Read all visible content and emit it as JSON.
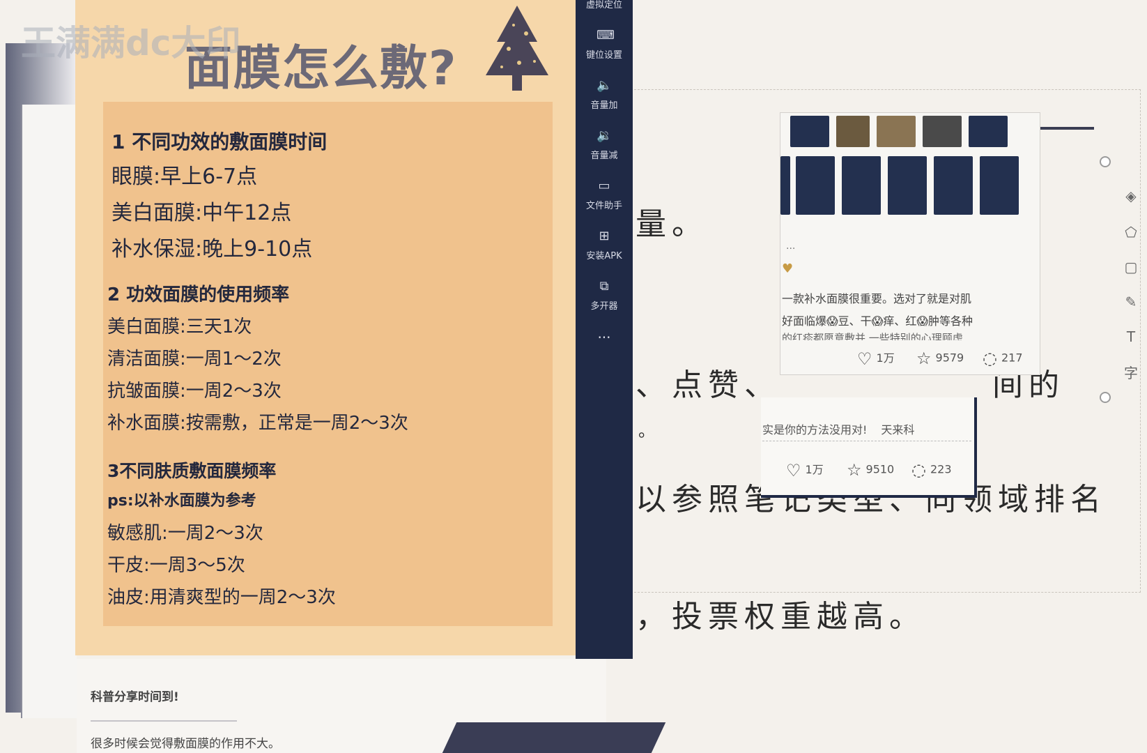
{
  "watermark": "王满满dc大印",
  "poster": {
    "title": "面膜怎么敷?",
    "sections": [
      {
        "heading": "1  不同功效的敷面膜时间",
        "lines": [
          "眼膜:早上6-7点",
          "美白面膜:中午12点",
          "补水保湿:晚上9-10点"
        ]
      },
      {
        "heading": "2  功效面膜的使用频率",
        "lines": [
          "美白面膜:三天1次",
          "清洁面膜:一周1～2次",
          "抗皱面膜:一周2～3次",
          "补水面膜:按需敷，正常是一周2～3次"
        ]
      },
      {
        "heading": "3不同肤质敷面膜频率",
        "subheading": "ps:以补水面膜为参考",
        "lines": [
          "敏感肌:一周2～3次",
          "干皮:一周3～5次",
          "油皮:用清爽型的一周2～3次"
        ]
      }
    ]
  },
  "sidebar": {
    "top_partial": "虚拟定位",
    "items": [
      {
        "label": "键位设置",
        "icon": "keyboard-icon"
      },
      {
        "label": "音量加",
        "icon": "volume-up-icon"
      },
      {
        "label": "音量减",
        "icon": "volume-down-icon"
      },
      {
        "label": "文件助手",
        "icon": "monitor-icon"
      },
      {
        "label": "安装APK",
        "icon": "install-apk-icon"
      },
      {
        "label": "多开器",
        "icon": "multi-open-icon"
      }
    ],
    "more": "..."
  },
  "bottom_card": {
    "line1": "科普分享时间到!",
    "line2": "很多时候会觉得敷面膜的作用不大。"
  },
  "document": {
    "line1": "量。",
    "line2": "、点赞、",
    "line2_tail": "间的",
    "line3": "。",
    "line4": "以参照笔记类型、同领域排名",
    "line5": "，投票权重越高。"
  },
  "card1": {
    "dots": "...",
    "line1": "一款补水面膜很重要。选对了就是对肌",
    "line2": "好面临爆😱豆、干😱痒、红😱肿等各种",
    "line3": "的红疹都愿意敷并 一些特别的心理顾虑",
    "likes": "1万",
    "favorites": "9579",
    "comments": "217"
  },
  "card2": {
    "text": "实是你的方法没用对!",
    "text_tail": "天来科",
    "likes": "1万",
    "favorites": "9510",
    "comments": "223"
  },
  "right_tools": [
    "layers-icon",
    "shapes-icon",
    "crop-icon",
    "pen-icon",
    "text-transform-icon",
    "font-icon"
  ],
  "colors": {
    "poster_bg": "#f6d7aa",
    "poster_box": "#f0c28d",
    "sidebar": "#1f2945",
    "doc_bg": "#f4f1ec"
  }
}
